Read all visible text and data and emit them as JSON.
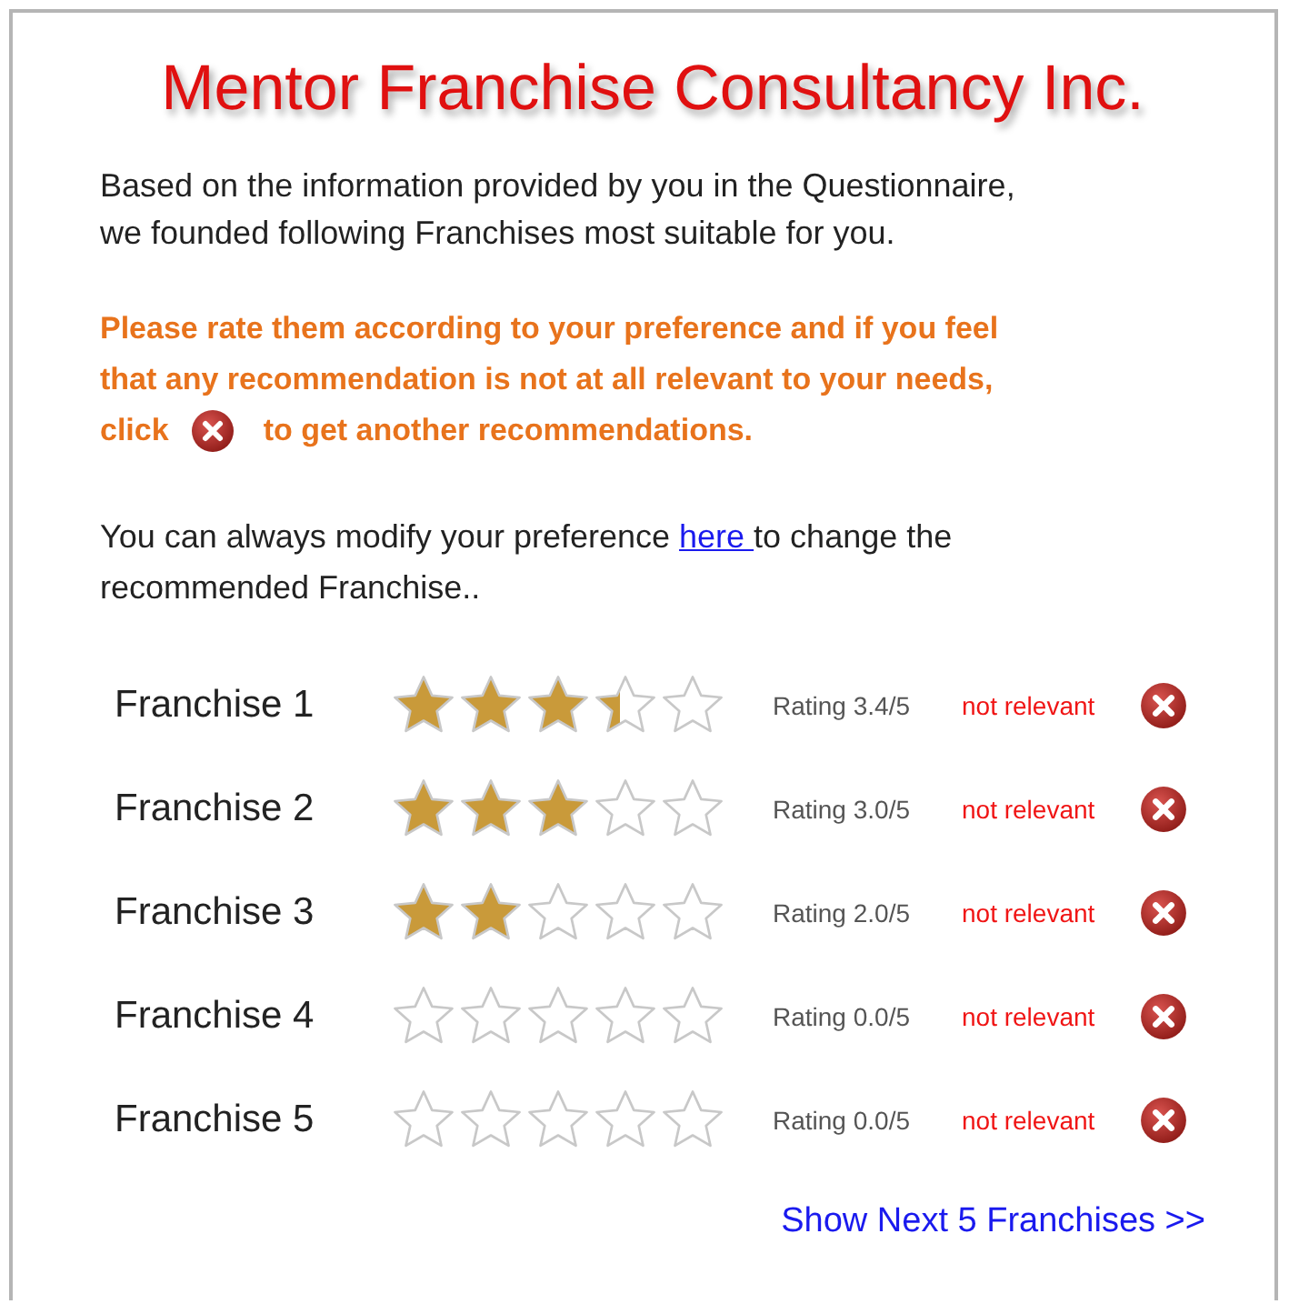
{
  "title": "Mentor Franchise Consultancy Inc.",
  "intro": "Based on the information provided by you in the Questionnaire, we founded following Franchises most suitable for you.",
  "instruction": {
    "lines": [
      "Please rate them according to your preference and if you feel",
      "that any recommendation is not at all relevant to your needs,"
    ],
    "before": "click",
    "after": "to get another recommendations."
  },
  "modify_note": {
    "before": "You can always modify your preference ",
    "link": "here ",
    "after": "to change the recommended Franchise.."
  },
  "franchises": [
    {
      "name": "Franchise 1",
      "stars": 3.4,
      "rating": "Rating 3.4/5",
      "action": "not relevant"
    },
    {
      "name": "Franchise 2",
      "stars": 3,
      "rating": "Rating 3.0/5",
      "action": "not relevant"
    },
    {
      "name": "Franchise 3",
      "stars": 2,
      "rating": "Rating 2.0/5",
      "action": "not relevant"
    },
    {
      "name": "Franchise 4",
      "stars": 0,
      "rating": "Rating 0.0/5",
      "action": "not relevant"
    },
    {
      "name": "Franchise 5",
      "stars": 0,
      "rating": "Rating 0.0/5",
      "action": "not relevant"
    }
  ],
  "next_link": "Show Next 5 Franchises >>"
}
